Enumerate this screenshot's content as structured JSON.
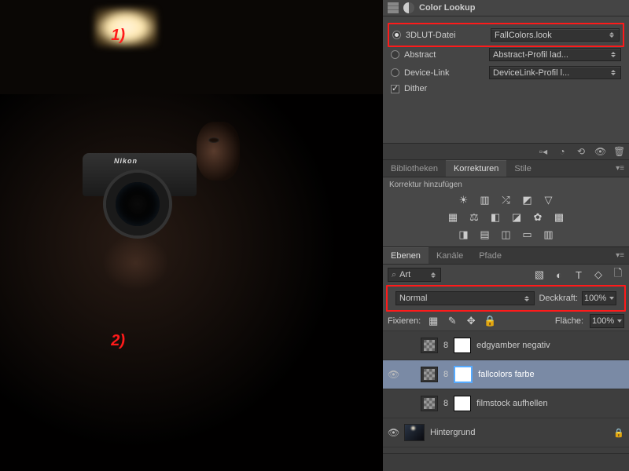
{
  "annots": {
    "one": "1)",
    "two": "2)"
  },
  "properties": {
    "title": "Color Lookup",
    "lut": {
      "label": "3DLUT-Datei",
      "value": "FallColors.look"
    },
    "abstract": {
      "label": "Abstract",
      "value": "Abstract-Profil lad..."
    },
    "devicelink": {
      "label": "Device-Link",
      "value": "DeviceLink-Profil l..."
    },
    "dither": "Dither"
  },
  "tabgroup1": {
    "lib": "Bibliotheken",
    "korr": "Korrekturen",
    "stile": "Stile",
    "addlabel": "Korrektur hinzufügen"
  },
  "layerTabs": {
    "ebenen": "Ebenen",
    "kanale": "Kanäle",
    "pfade": "Pfade"
  },
  "layerTop": {
    "search": "Art",
    "blend": "Normal",
    "opacityLabel": "Deckkraft:",
    "opacity": "100%",
    "lockLabel": "Fixieren:",
    "fillLabel": "Fläche:",
    "fill": "100%"
  },
  "layers": {
    "l1": "edgyamber negativ",
    "l2": "fallcolors farbe",
    "l3": "filmstock aufhellen",
    "bg": "Hintergrund"
  }
}
